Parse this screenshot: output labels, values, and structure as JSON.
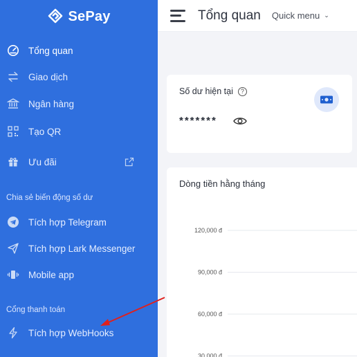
{
  "brand": {
    "name": "SePay"
  },
  "colors": {
    "sidebar": "#2f6fde",
    "arrow": "#e0201c"
  },
  "sidebar": {
    "items": [
      {
        "label": "Tổng quan",
        "icon": "dashboard-gauge-icon",
        "active": true
      },
      {
        "label": "Giao dịch",
        "icon": "transfer-arrows-icon"
      },
      {
        "label": "Ngân hàng",
        "icon": "bank-icon"
      },
      {
        "label": "Tạo QR",
        "icon": "qr-code-icon"
      },
      {
        "label": "Ưu đãi",
        "icon": "gift-icon",
        "external": true
      }
    ],
    "section_balance": "Chia sẻ biến động số dư",
    "share_items": [
      {
        "label": "Tích hợp Telegram",
        "icon": "telegram-icon"
      },
      {
        "label": "Tích hợp Lark Messenger",
        "icon": "send-icon"
      },
      {
        "label": "Mobile app",
        "icon": "mobile-vibrate-icon"
      }
    ],
    "section_payment": "Cổng thanh toán",
    "payment_items": [
      {
        "label": "Tích hợp WebHooks",
        "icon": "lightning-icon"
      }
    ]
  },
  "header": {
    "title": "Tổng quan",
    "quick_menu": "Quick menu"
  },
  "balance": {
    "title": "Số dư hiện tại",
    "value": "*******"
  },
  "cashflow": {
    "title": "Dòng tiền hằng tháng"
  },
  "chart_data": {
    "type": "bar",
    "title": "Dòng tiền hằng tháng",
    "y_ticks": [
      "120,000 đ",
      "90,000 đ",
      "60,000 đ",
      "30,000 đ"
    ],
    "y_values": [
      120000,
      90000,
      60000,
      30000
    ]
  }
}
